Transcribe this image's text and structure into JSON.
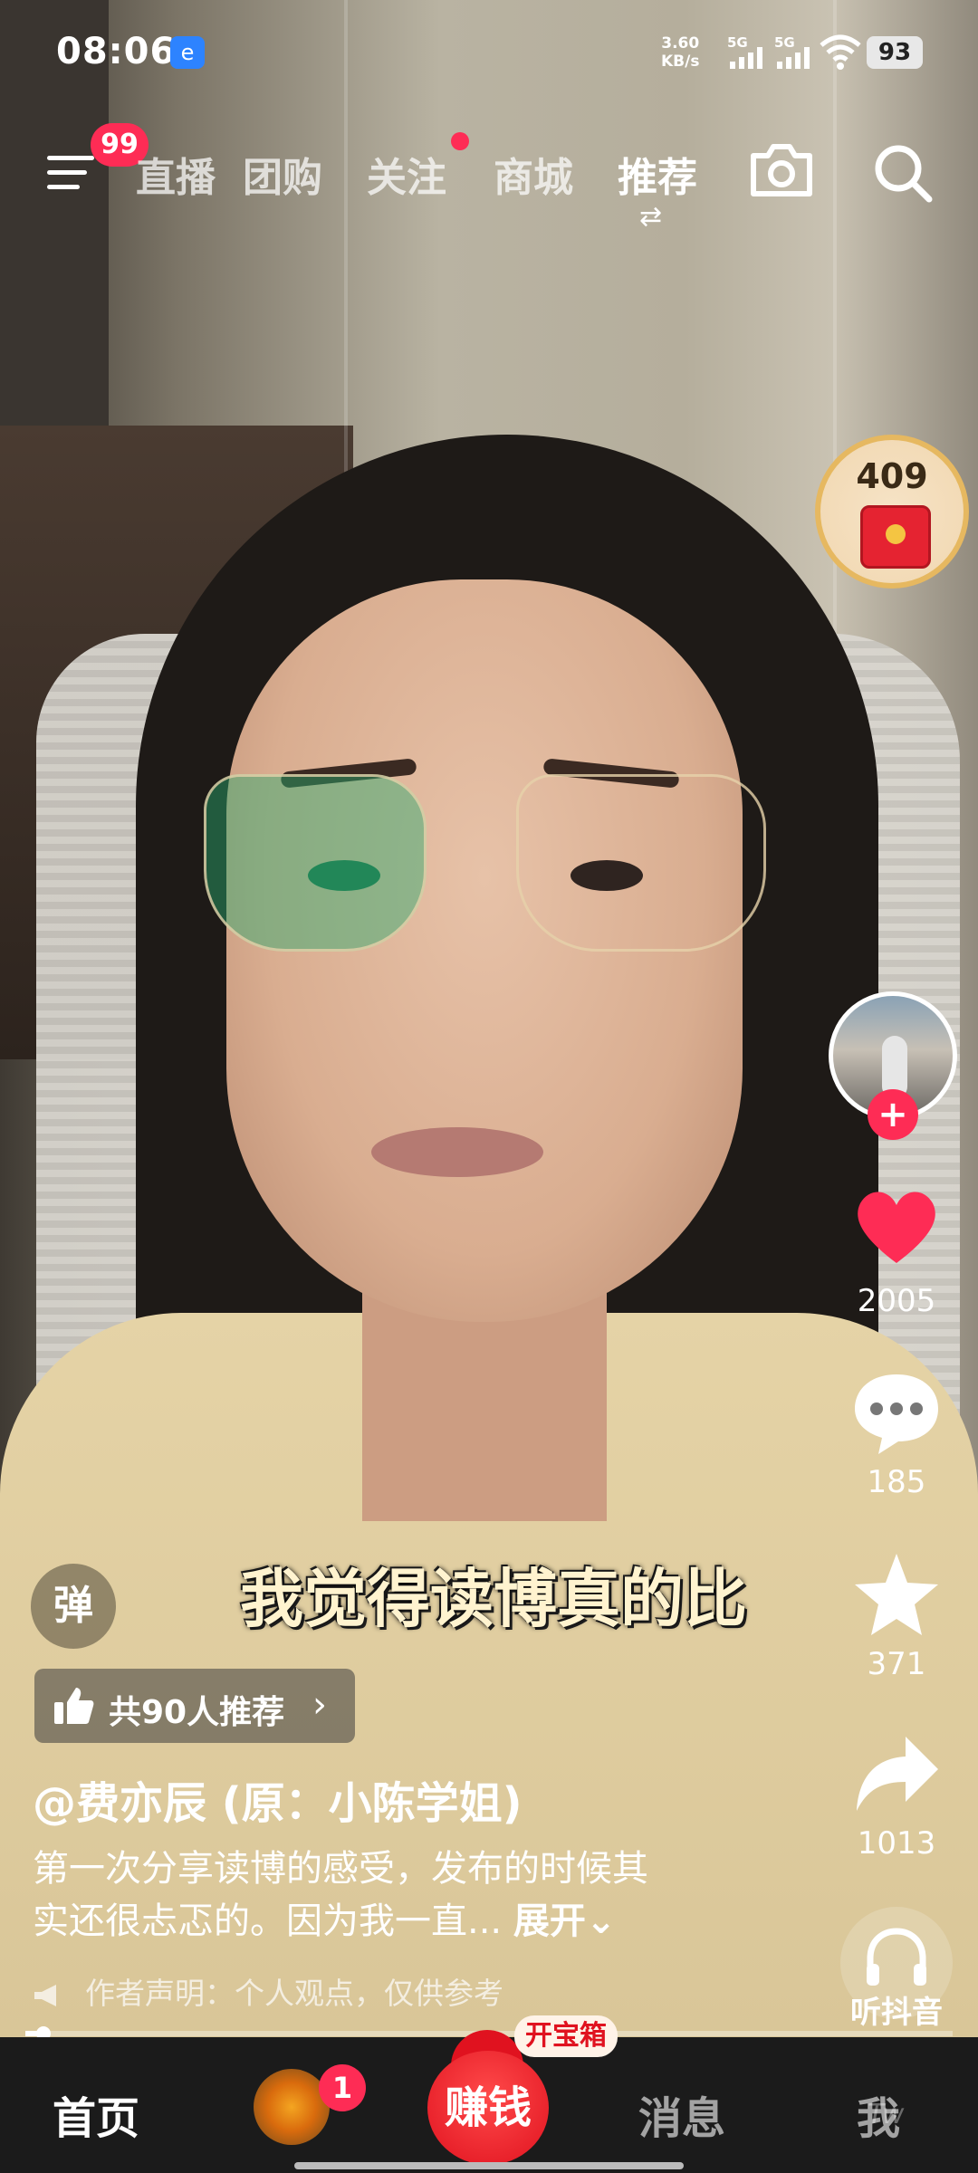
{
  "status_bar": {
    "time": "08:06",
    "net_speed": "3.60",
    "net_unit": "KB/s",
    "signal1": "5G",
    "signal2": "5G",
    "battery": "93"
  },
  "top_nav": {
    "menu_badge": "99",
    "tabs": [
      "直播",
      "团购",
      "关注",
      "商城",
      "推荐"
    ],
    "active_tab": "推荐",
    "accent_color": "#fe2c55"
  },
  "right_rail": {
    "timer_count": "409",
    "follow_label": "+",
    "likes": "2005",
    "comments": "185",
    "favorites": "371",
    "shares": "1013",
    "listen_label": "听抖音"
  },
  "video": {
    "danmaku_label": "弹",
    "subtitle": "我觉得读博真的比",
    "recommend_text": "共90人推荐",
    "author": "@费亦辰 (原：小陈学姐)",
    "caption_line1": "第一次分享读博的感受，发布的时候其",
    "caption_line2": "实还很忐忑的。因为我一直...",
    "expand_label": "展开",
    "disclaimer": "作者声明：个人观点，仅供参考",
    "progress": 0.02
  },
  "bottom_bar": {
    "tabs": [
      "首页",
      "消息",
      "我"
    ],
    "friends_badge": "1",
    "earn_label": "赚钱",
    "treasure_label": "开宝箱",
    "watermark": "Tw"
  }
}
